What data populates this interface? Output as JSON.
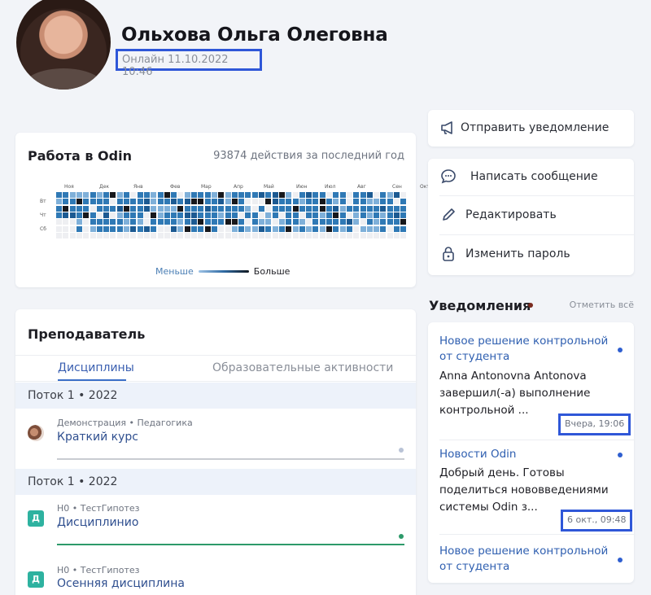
{
  "profile": {
    "name": "Ольхова Ольга Олеговна",
    "status": "Онлайн 11.10.2022 10:46"
  },
  "activity": {
    "title": "Работа в Odin",
    "summary": "93874 действия за последний год",
    "months": [
      "Ноя",
      "Дек",
      "Янв",
      "Фев",
      "Мар",
      "Апр",
      "Май",
      "Июн",
      "Июл",
      "Авг",
      "Сен",
      "Окт"
    ],
    "weekdays": [
      "Вт",
      "Чт",
      "Сб"
    ],
    "legend_less": "Меньше",
    "legend_more": "Больше",
    "colors": {
      "empty": "#eeeff2",
      "low": "#7fb0d9",
      "mid": "#2f79b5",
      "high": "#1c5a92",
      "max": "#17181c"
    }
  },
  "teacher": {
    "title": "Преподаватель",
    "tabs": [
      {
        "label": "Дисциплины",
        "active": true
      },
      {
        "label": "Образовательные активности",
        "active": false
      }
    ],
    "groups": [
      {
        "stream": "Поток 1 • 2022",
        "course": {
          "meta": "Демонстрация • Педагогика",
          "name": "Краткий курс",
          "icon": "avatar-icon"
        }
      },
      {
        "stream": "Поток 1 • 2022",
        "courses": [
          {
            "meta": "Н0 • ТестГипотез",
            "name": "Дисциплинио",
            "icon_letter": "Д"
          },
          {
            "meta": "Н0 • ТестГипотез",
            "name": "Осенняя дисциплина",
            "icon_letter": "Д"
          }
        ]
      }
    ]
  },
  "actions": {
    "notify": "Отправить уведомление",
    "message": "Написать сообщение",
    "edit": "Редактировать",
    "password": "Изменить пароль"
  },
  "notifications": {
    "title": "Уведомления",
    "mark_all": "Отметить всё",
    "items": [
      {
        "title": "Новое решение контрольной от студента",
        "body": "Anna Antonovna Antonova завершил(-а) выполнение контрольной ...",
        "time": "Вчера, 19:06"
      },
      {
        "title": "Новости Odin",
        "body": "Добрый день. Готовы поделиться нововведениями системы Odin з...",
        "time": "6 окт., 09:48"
      },
      {
        "title": "Новое решение контрольной от студента",
        "body": "",
        "time": ""
      }
    ]
  }
}
